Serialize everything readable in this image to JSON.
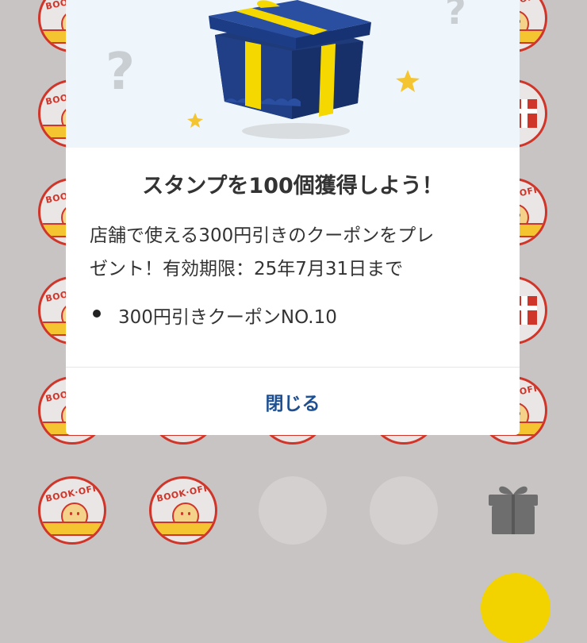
{
  "modal": {
    "title": "スタンプを100個獲得しよう！",
    "description_line1": "店舗で使える300円引きのクーポンをプレ",
    "description_line2": "ゼント！有効期限：25年7月31日まで",
    "reward_items": [
      "300円引きクーポンNO.10"
    ],
    "close_label": "閉じる"
  },
  "stamp_brand_text": "BOOK·OFF",
  "colors": {
    "accent_blue": "#1d4f91",
    "stamp_red": "#d0352a",
    "gift_yellow": "#f5d800",
    "gift_navy": "#1f3a78",
    "overlay": "#c7c4c3"
  },
  "icons": {
    "hero": "gift-box-icon",
    "question": "question-mark-icon",
    "star": "star-icon",
    "locked_reward": "grey-gift-icon"
  }
}
